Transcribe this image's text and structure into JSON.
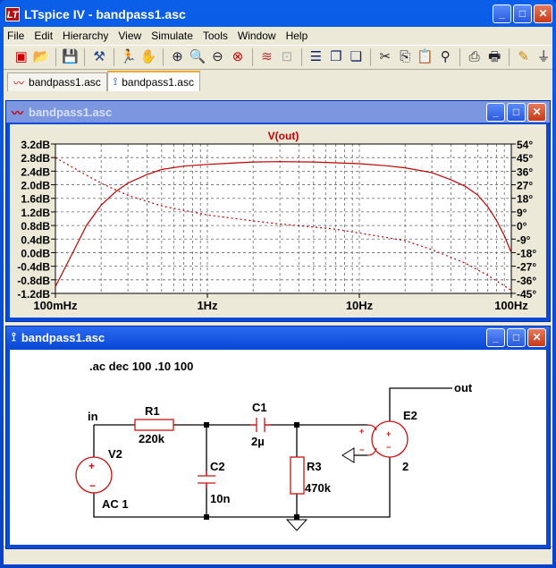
{
  "app": {
    "title": "LTspice IV - bandpass1.asc",
    "logo": "LT"
  },
  "menu": [
    "File",
    "Edit",
    "Hierarchy",
    "View",
    "Simulate",
    "Tools",
    "Window",
    "Help"
  ],
  "toolbar": [
    "new-schematic",
    "open",
    "save",
    "control-panel",
    "run",
    "halt",
    "zoom-in",
    "zoom-area",
    "zoom-out",
    "zoom-fit",
    "autorange",
    "mark-unref",
    "tile-horizontal",
    "cascade",
    "tile-vertical",
    "cut",
    "copy",
    "paste",
    "find",
    "print-setup",
    "print",
    "draw-wire",
    "ground"
  ],
  "tabs": [
    {
      "label": "bandpass1.asc",
      "icon": "waveform-icon"
    },
    {
      "label": "bandpass1.asc",
      "icon": "schematic-icon",
      "active": true
    }
  ],
  "plot_window": {
    "title": "bandpass1.asc"
  },
  "schematic_window": {
    "title": "bandpass1.asc"
  },
  "colors": {
    "trace": "#c00000",
    "component": "#d01010",
    "wire": "#000000"
  },
  "chart_data": {
    "type": "line",
    "title": "V(out)",
    "xscale": "log",
    "xlim": [
      0.1,
      100
    ],
    "x_ticks": [
      "100mHz",
      "1Hz",
      "10Hz",
      "100Hz"
    ],
    "y_left_ticks": [
      "3.2dB",
      "2.8dB",
      "2.4dB",
      "2.0dB",
      "1.6dB",
      "1.2dB",
      "0.8dB",
      "0.4dB",
      "0.0dB",
      "-0.4dB",
      "-0.8dB",
      "-1.2dB"
    ],
    "y_right_ticks": [
      "54°",
      "45°",
      "36°",
      "27°",
      "18°",
      "9°",
      "0°",
      "-9°",
      "-18°",
      "-27°",
      "-36°",
      "-45°"
    ],
    "ylim_left": [
      -1.2,
      3.2
    ],
    "ylim_right": [
      -45,
      54
    ],
    "grid": true,
    "series": [
      {
        "name": "magnitude (dB)",
        "style": "solid",
        "x": [
          0.1,
          0.13,
          0.16,
          0.2,
          0.25,
          0.3,
          0.4,
          0.5,
          0.7,
          1,
          2,
          3,
          5,
          10,
          15,
          20,
          30,
          40,
          50,
          60,
          70,
          80,
          90,
          100
        ],
        "y": [
          -1.0,
          0.0,
          0.8,
          1.4,
          1.8,
          2.05,
          2.3,
          2.45,
          2.55,
          2.6,
          2.67,
          2.68,
          2.67,
          2.62,
          2.56,
          2.5,
          2.36,
          2.15,
          1.95,
          1.7,
          1.35,
          0.95,
          0.5,
          0.0
        ]
      },
      {
        "name": "phase (deg)",
        "style": "dashed",
        "x": [
          0.1,
          0.15,
          0.2,
          0.3,
          0.5,
          0.7,
          1,
          2,
          3,
          5,
          7,
          10,
          20,
          30,
          50,
          70,
          100
        ],
        "y": [
          45,
          35,
          28,
          20,
          13,
          10,
          7,
          3,
          1,
          -1,
          -2.5,
          -5,
          -10,
          -16,
          -25,
          -33,
          -43
        ]
      }
    ]
  },
  "schematic": {
    "directive": ".ac dec 100 .10 100",
    "labels": {
      "in": "in",
      "out": "out"
    },
    "components": [
      {
        "ref": "V2",
        "value": "AC 1"
      },
      {
        "ref": "R1",
        "value": "220k"
      },
      {
        "ref": "C2",
        "value": "10n"
      },
      {
        "ref": "C1",
        "value": "2µ"
      },
      {
        "ref": "R3",
        "value": "470k"
      },
      {
        "ref": "E2",
        "value": "2"
      }
    ],
    "pin_plus": "+",
    "pin_minus": "−"
  }
}
